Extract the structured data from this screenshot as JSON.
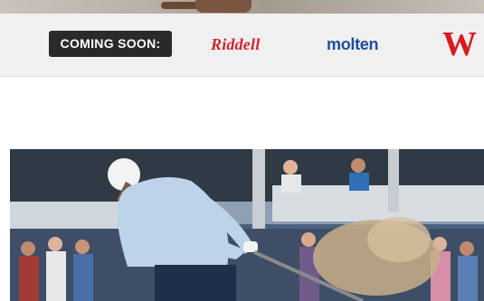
{
  "top_image": {
    "description_icon": "photo-strip"
  },
  "sponsors": {
    "coming_soon_label": "COMING SOON:",
    "logos": [
      {
        "name": "Riddell",
        "text": "Riddell",
        "color": "#d1262f"
      },
      {
        "name": "molten",
        "text": "molten",
        "color": "#1d4fa0"
      },
      {
        "name": "Wilson",
        "text": "W",
        "color": "#d71920"
      }
    ]
  },
  "hero": {
    "icon": "golfer-photo"
  },
  "colors": {
    "sponsor_bar_bg": "#f0f0f0",
    "badge_bg": "#2a2a2a"
  }
}
